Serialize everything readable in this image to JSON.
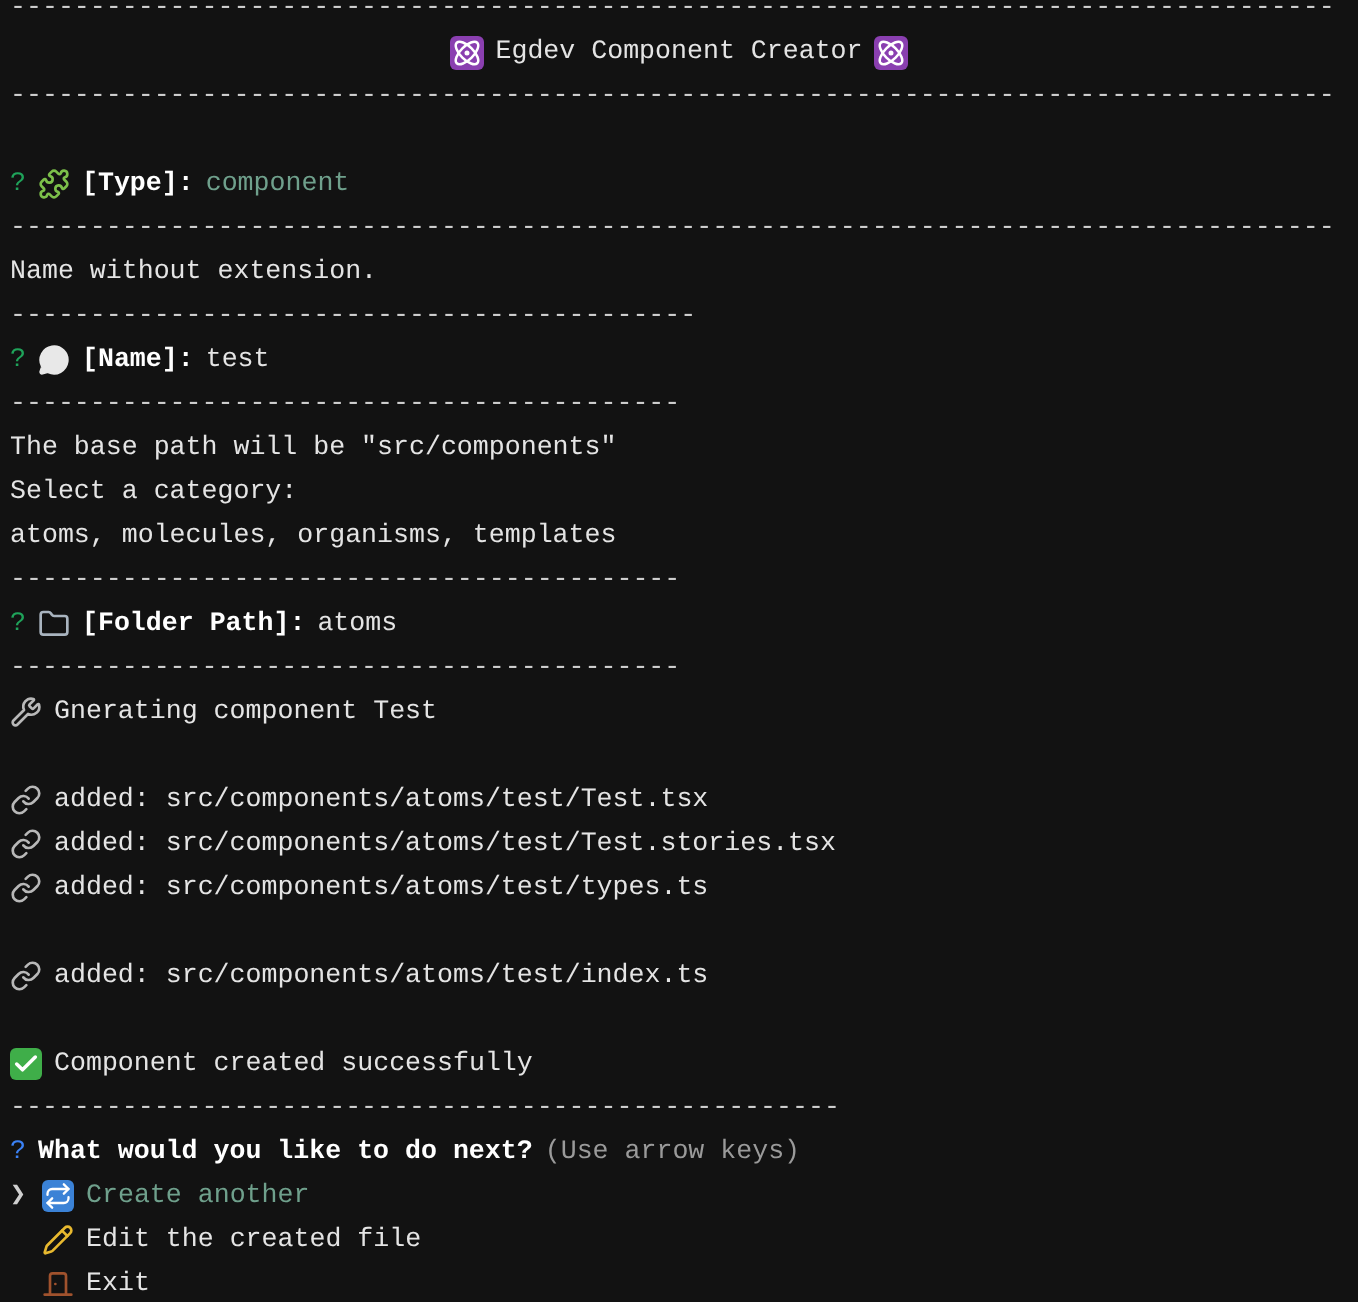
{
  "pointer": "❯",
  "lines": [
    {
      "kind": "rule",
      "text": "-----------------------------------------------------------------------------------"
    },
    {
      "kind": "title",
      "text": "Egdev Component Creator"
    },
    {
      "kind": "rule",
      "text": "-----------------------------------------------------------------------------------"
    },
    {
      "kind": "blank"
    },
    {
      "kind": "prompt",
      "mark": "?",
      "label": "[Type]:",
      "answer": "component",
      "answer_highlighted": true
    },
    {
      "kind": "rule",
      "text": "-----------------------------------------------------------------------------------"
    },
    {
      "kind": "text",
      "text": "Name without extension."
    },
    {
      "kind": "rule",
      "text": "-------------------------------------------"
    },
    {
      "kind": "prompt",
      "mark": "?",
      "label": "[Name]:",
      "answer": "test",
      "answer_highlighted": false
    },
    {
      "kind": "rule",
      "text": "------------------------------------------"
    },
    {
      "kind": "text",
      "text": "The base path will be \"src/components\""
    },
    {
      "kind": "text",
      "text": "Select a category:"
    },
    {
      "kind": "text",
      "text": "atoms, molecules, organisms, templates"
    },
    {
      "kind": "rule",
      "text": "------------------------------------------"
    },
    {
      "kind": "prompt",
      "mark": "?",
      "label": "[Folder Path]:",
      "answer": "atoms",
      "answer_highlighted": false
    },
    {
      "kind": "rule",
      "text": "------------------------------------------"
    },
    {
      "kind": "status",
      "text": "Gnerating component Test"
    },
    {
      "kind": "blank"
    },
    {
      "kind": "added",
      "text": "added: src/components/atoms/test/Test.tsx"
    },
    {
      "kind": "added",
      "text": "added: src/components/atoms/test/Test.stories.tsx"
    },
    {
      "kind": "added",
      "text": "added: src/components/atoms/test/types.ts"
    },
    {
      "kind": "blank"
    },
    {
      "kind": "added",
      "text": "added: src/components/atoms/test/index.ts"
    },
    {
      "kind": "blank"
    },
    {
      "kind": "success",
      "text": "Component created successfully"
    },
    {
      "kind": "rule",
      "text": "----------------------------------------------------"
    },
    {
      "kind": "question",
      "mark": "?",
      "text": "What would you like to do next?",
      "hint": "(Use arrow keys)"
    },
    {
      "kind": "option",
      "text": "Create another",
      "selected": true
    },
    {
      "kind": "option",
      "text": "Edit the created file",
      "selected": false
    },
    {
      "kind": "option",
      "text": "Exit",
      "selected": false
    }
  ]
}
